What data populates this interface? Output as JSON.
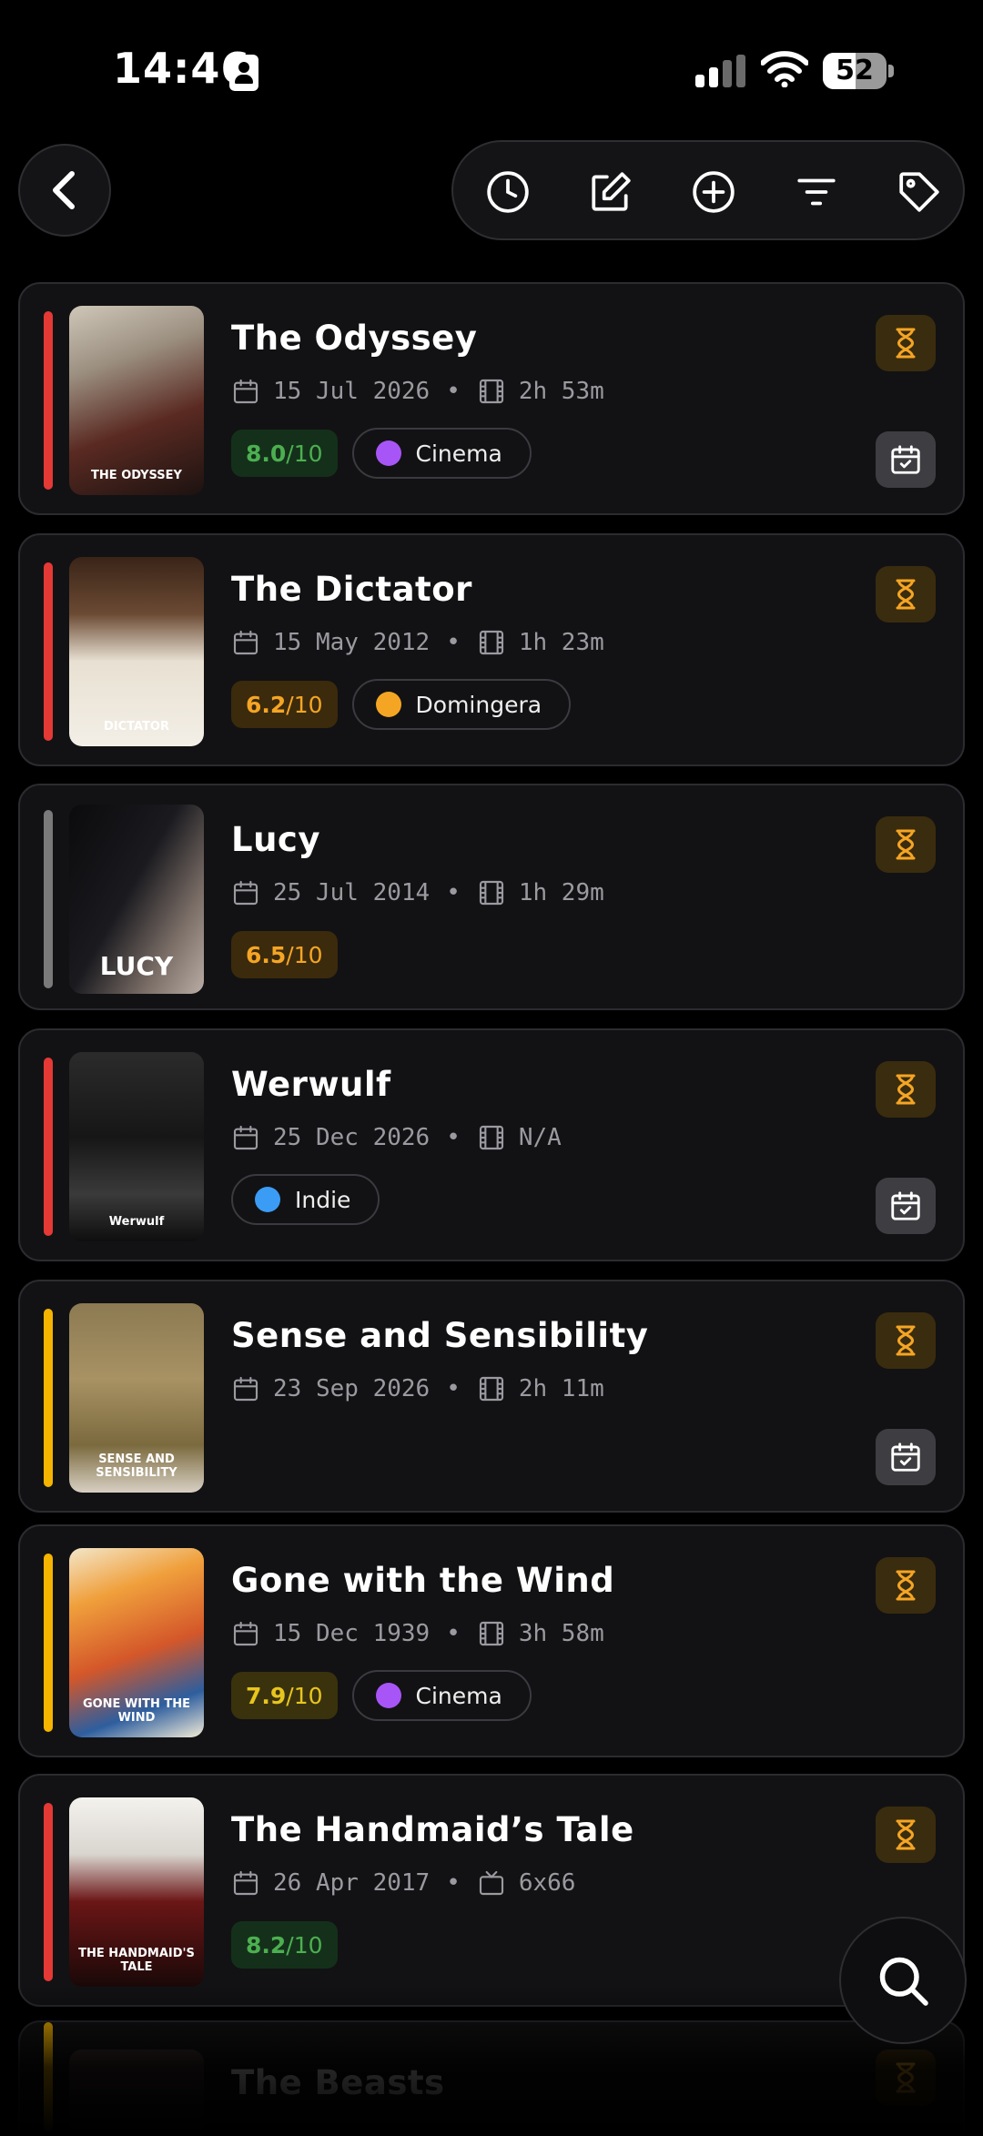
{
  "status_bar": {
    "time": "14:46",
    "battery": "52",
    "battery_level": 0.52
  },
  "toolbar": {
    "buttons": [
      "history-icon",
      "edit-icon",
      "add-icon",
      "filter-icon",
      "tag-icon"
    ]
  },
  "colors": {
    "accent_red": "#e53935",
    "accent_gray": "#7a7a7a",
    "accent_yellow": "#f5b400",
    "pending": "#f5a524"
  },
  "items": [
    {
      "title": "The Odyssey",
      "date": "15 Jul 2026",
      "runtime": "2h 53m",
      "runtime_icon": "film-icon",
      "score": "8.0",
      "score_max": "/10",
      "score_color": "green",
      "category": "Cinema",
      "category_color": "#a855f7",
      "accent": "red",
      "has_calendar": true,
      "poster_caption": "THE ODYSSEY"
    },
    {
      "title": "The Dictator",
      "date": "15 May 2012",
      "runtime": "1h 23m",
      "runtime_icon": "film-icon",
      "score": "6.2",
      "score_max": "/10",
      "score_color": "orange",
      "category": "Domingera",
      "category_color": "#f5a524",
      "accent": "red",
      "has_calendar": false,
      "poster_caption": "DICTATOR"
    },
    {
      "title": "Lucy",
      "date": "25 Jul 2014",
      "runtime": "1h 29m",
      "runtime_icon": "film-icon",
      "score": "6.5",
      "score_max": "/10",
      "score_color": "orange",
      "category": "",
      "category_color": "",
      "accent": "gray",
      "has_calendar": false,
      "poster_caption": "LUCY"
    },
    {
      "title": "Werwulf",
      "date": "25 Dec 2026",
      "runtime": "N/A",
      "runtime_icon": "film-icon",
      "score": "",
      "score_max": "",
      "score_color": "",
      "category": "Indie",
      "category_color": "#3b9cf5",
      "accent": "red",
      "has_calendar": true,
      "poster_caption": "Werwulf"
    },
    {
      "title": "Sense and Sensibility",
      "date": "23 Sep 2026",
      "runtime": "2h 11m",
      "runtime_icon": "film-icon",
      "score": "",
      "score_max": "",
      "score_color": "",
      "category": "",
      "category_color": "",
      "accent": "yellow",
      "has_calendar": true,
      "poster_caption": "SENSE AND SENSIBILITY"
    },
    {
      "title": "Gone with the Wind",
      "date": "15 Dec 1939",
      "runtime": "3h 58m",
      "runtime_icon": "film-icon",
      "score": "7.9",
      "score_max": "/10",
      "score_color": "yellow",
      "category": "Cinema",
      "category_color": "#a855f7",
      "accent": "yellow",
      "has_calendar": false,
      "poster_caption": "GONE WITH THE WIND"
    },
    {
      "title": "The Handmaid’s Tale",
      "date": "26 Apr 2017",
      "runtime": "6x66",
      "runtime_icon": "tv-icon",
      "score": "8.2",
      "score_max": "/10",
      "score_color": "green",
      "category": "",
      "category_color": "",
      "accent": "red",
      "has_calendar": false,
      "poster_caption": "THE HANDMAID'S TALE"
    },
    {
      "title": "The Beasts",
      "date": "",
      "runtime": "",
      "runtime_icon": "",
      "score": "",
      "score_max": "",
      "score_color": "",
      "category": "",
      "category_color": "",
      "accent": "yellow",
      "has_calendar": false,
      "poster_caption": ""
    }
  ]
}
